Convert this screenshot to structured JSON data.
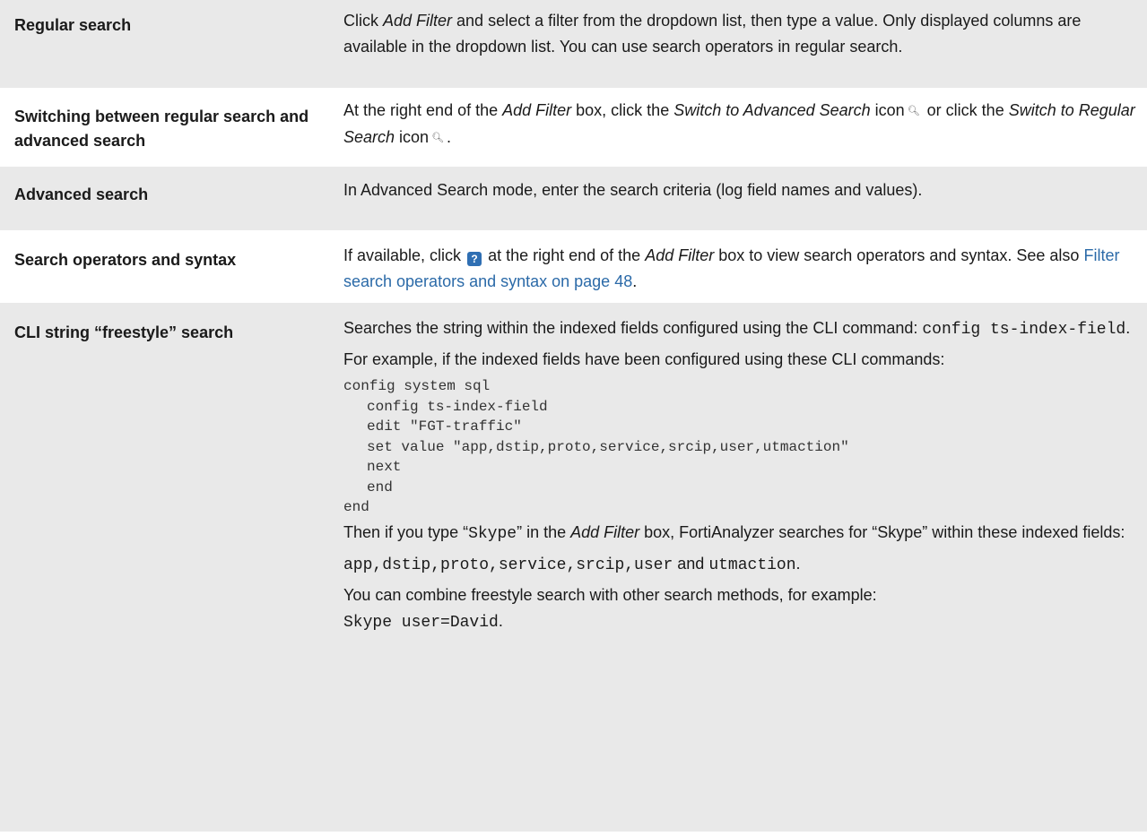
{
  "rows": [
    {
      "term": "Regular search",
      "desc_parts": [
        "Click ",
        "Add Filter",
        " and select a filter from the dropdown list, then type a value. Only displayed columns are available in the dropdown list. You can use search operators in regular search."
      ]
    },
    {
      "term": "Switching between regular search and advanced search",
      "desc_parts": [
        "At the right end of the ",
        "Add Filter",
        " box, click the ",
        "Switch to Advanced Search",
        " icon",
        " or click the ",
        "Switch to Regular Search",
        " icon",
        "."
      ]
    },
    {
      "term": "Advanced search",
      "desc": "In Advanced Search mode, enter the search criteria (log field names and values)."
    },
    {
      "term": "Search operators and syntax",
      "desc_parts": [
        "If available, click ",
        " at the right end of the ",
        "Add Filter",
        " box to view search operators and syntax. See also ",
        "Filter search operators and syntax on page 48",
        "."
      ]
    },
    {
      "term": "CLI string “freestyle” search",
      "p1_parts": [
        "Searches the string within the indexed fields configured using the CLI command: ",
        "config ts-index-field",
        "."
      ],
      "p2": "For example, if the indexed fields have been configured using these CLI commands:",
      "code": [
        "config system sql",
        "config ts-index-field",
        "edit \"FGT-traffic\"",
        "set value \"app,dstip,proto,service,srcip,user,utmaction\"",
        "next",
        "end",
        "end"
      ],
      "p3_parts": [
        "Then if you type “",
        "Skype",
        "” in the ",
        "Add Filter",
        " box, FortiAnalyzer searches for “Skype” within these indexed fields:"
      ],
      "p4_parts": [
        "app,dstip,proto,service,srcip,user",
        " and ",
        "utmaction",
        "."
      ],
      "p5_parts": [
        "You can combine freestyle search with other search methods, for example:",
        "Skype user=David",
        "."
      ]
    }
  ],
  "icons": {
    "advanced_search_icon": "search-advanced-icon",
    "regular_search_icon": "search-regular-icon",
    "help_icon_glyph": "?"
  },
  "colors": {
    "shaded_row": "#e9e9e9",
    "link": "#2b6aa8"
  }
}
